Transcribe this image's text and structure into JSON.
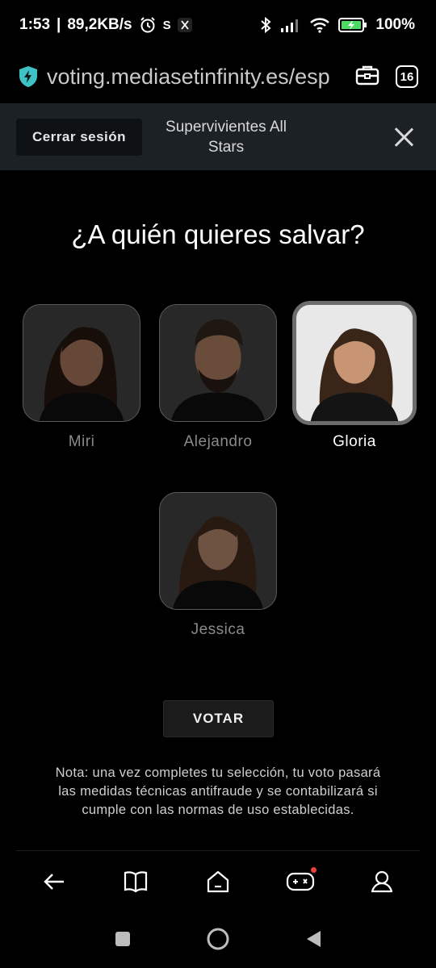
{
  "status_bar": {
    "time": "1:53",
    "speed": "89,2KB/s",
    "battery": "100%"
  },
  "browser": {
    "url": "voting.mediasetinfinity.es/esp",
    "tab_count": "16"
  },
  "header": {
    "logout_label": "Cerrar sesión",
    "title": "Supervivientes All Stars"
  },
  "question": "¿A quién quieres salvar?",
  "candidates": [
    {
      "name": "Miri",
      "selected": false
    },
    {
      "name": "Alejandro",
      "selected": false
    },
    {
      "name": "Gloria",
      "selected": true
    },
    {
      "name": "Jessica",
      "selected": false
    }
  ],
  "vote_label": "VOTAR",
  "note": "Nota: una vez completes tu selección, tu voto pasará las medidas técnicas antifraude y se contabilizará si cumple con las normas de uso establecidas.",
  "colors": {
    "header_bg": "#1c2125",
    "shield": "#3fc2c6",
    "battery_fill": "#4cd964",
    "notification_dot": "#e8413c"
  }
}
